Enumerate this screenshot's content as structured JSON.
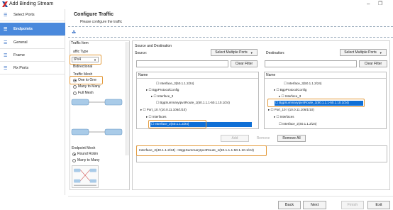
{
  "window": {
    "title": "Add Binding Stream",
    "minimize": "–",
    "maximize": "❐"
  },
  "sidebar": {
    "items": [
      {
        "label": "Select Ports",
        "icon": "list-icon"
      },
      {
        "label": "Endpoints",
        "icon": "list-icon",
        "active": true
      },
      {
        "label": "General",
        "icon": "list-icon"
      },
      {
        "label": "Frame",
        "icon": "list-icon"
      },
      {
        "label": "Rx Ports",
        "icon": "list-icon"
      }
    ]
  },
  "header": {
    "title": "Configure Traffic",
    "subtitle": "Please configure the traffic"
  },
  "traffic_item": {
    "legend": "Traffic Item",
    "type_label": "affic Type",
    "type_value": "IPv4",
    "bidirectional": "Bidirectional",
    "mesh_label": "Traffic Mesh",
    "mesh_options": [
      "One to One",
      "Many to Many",
      "Full Mesh"
    ],
    "mesh_selected": "One to One",
    "endpoint_mesh_label": "Endpoint Mesh",
    "endpoint_options": [
      "Round Robin",
      "Many to Many"
    ],
    "endpoint_selected": "Round Robin"
  },
  "source_dest": {
    "legend": "Source and Destination",
    "source_label": "Source:",
    "dest_label": "Destination:",
    "select_button": "Select Multiple Ports",
    "clear_filter": "Clear Filter",
    "name_header": "Name",
    "source_tree": [
      "Interface_3(50.1.1.2/24)",
      "BgpProtocolConfig",
      "Interface_3",
      "BgpSummaryIpv4Route_1(50.1.1.1-50.1.10.1/24)",
      "Port_10 / (10.0.11.106/1/10)",
      "Interfaces",
      "Interface_2(40.1.1.2/24)"
    ],
    "dest_tree": [
      "Interface_3(50.1.1.2/24)",
      "BgpProtocolConfig",
      "Interface_3",
      "BgpSummaryIpv4Route_1(50.1.1.1-50.1.10.1/24)",
      "Port_10 / (10.0.11.106/1/10)",
      "Interfaces",
      "Interface_2(40.1.1.2/24)"
    ],
    "add": "Add",
    "remove": "Remove",
    "remove_all": "Remove All",
    "result": "Interface_2(40.1.1.2/24) ->BgpSummaryIpv4Route_1(50.1.1.1-50.1.10.1/24)"
  },
  "footer": {
    "back": "Back",
    "next": "Next",
    "finish": "Finish",
    "exit": "Exit"
  },
  "colors": {
    "accent": "#4a89dc",
    "highlight": "#e39a3b",
    "selection": "#0f6fd6"
  }
}
